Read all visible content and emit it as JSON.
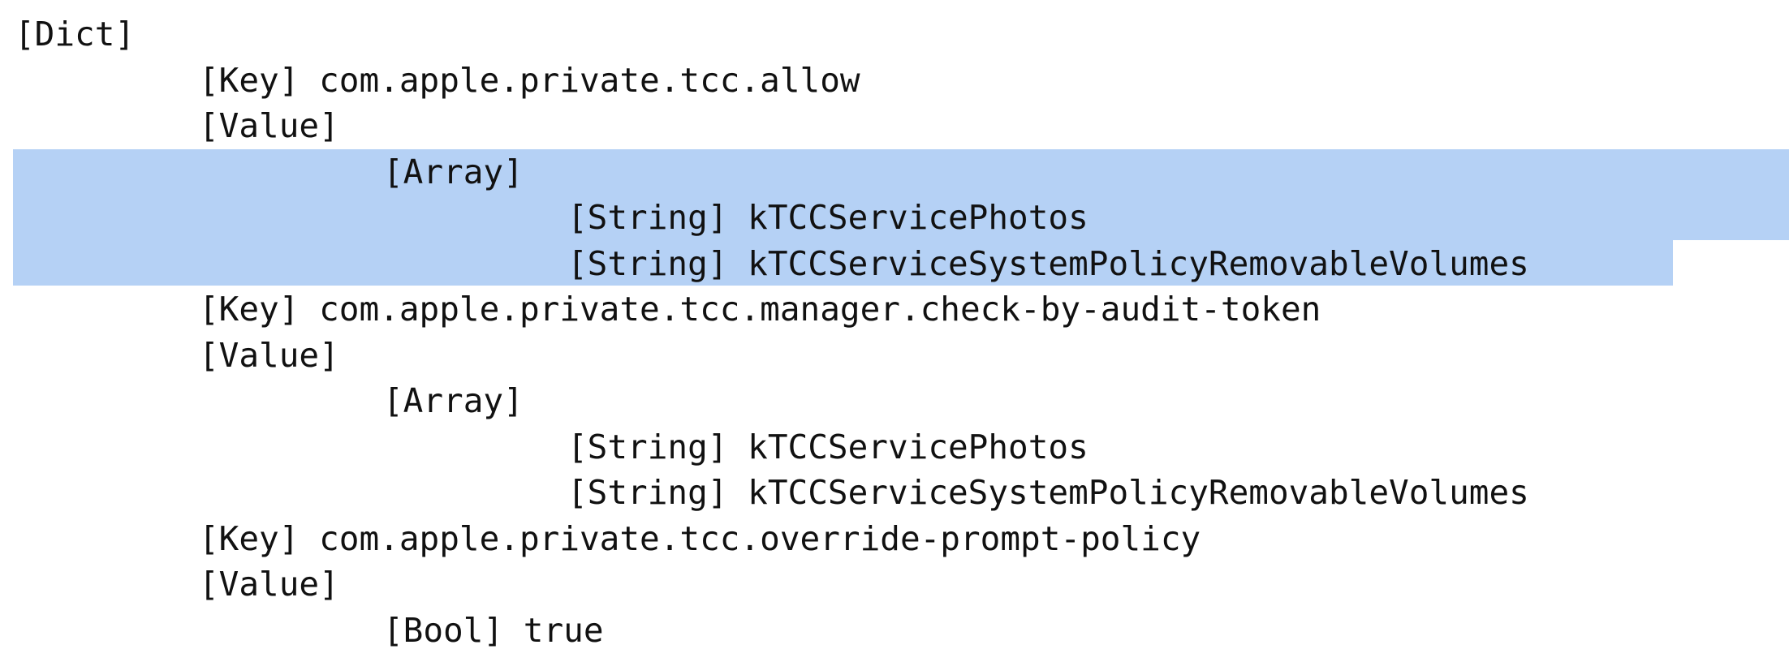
{
  "colors": {
    "background": "#ffffff",
    "text": "#111111",
    "selection": "#b5d1f5"
  },
  "lines": [
    "[Dict]",
    "[Key] com.apple.private.tcc.allow",
    "[Value]",
    "[Array]",
    "[String] kTCCServicePhotos",
    "[String] kTCCServiceSystemPolicyRemovableVolumes",
    "[Key] com.apple.private.tcc.manager.check-by-audit-token",
    "[Value]",
    "[Array]",
    "[String] kTCCServicePhotos",
    "[String] kTCCServiceSystemPolicyRemovableVolumes",
    "[Key] com.apple.private.tcc.override-prompt-policy",
    "[Value]",
    "[Bool] true"
  ]
}
